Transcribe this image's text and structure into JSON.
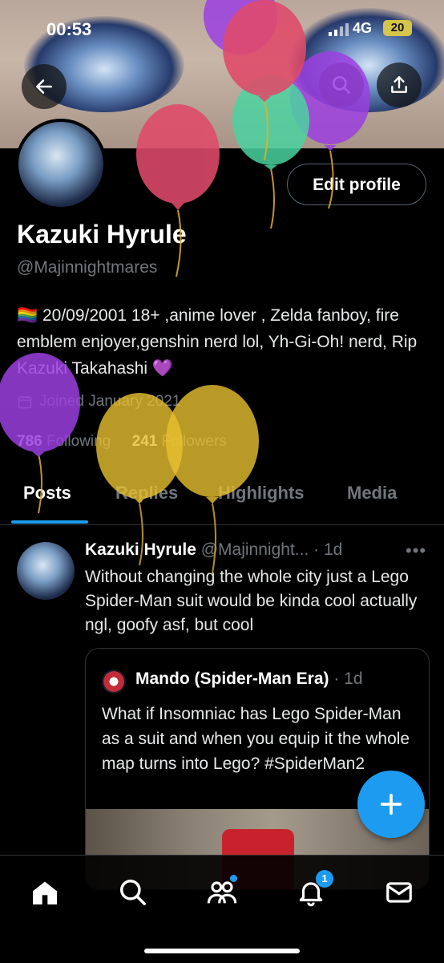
{
  "status_bar": {
    "time": "00:53",
    "network": "4G",
    "battery": "20"
  },
  "profile": {
    "name": "Kazuki Hyrule",
    "handle": "@Majinnightmares",
    "edit_label": "Edit profile",
    "bio": "🏳️‍🌈 20/09/2001 18+ ,anime lover , Zelda fanboy, fire emblem enjoyer,genshin nerd lol, Yh-Gi-Oh! nerd, Rip Kazuki Takahashi 💜",
    "joined": "Joined January 2021",
    "following_count": "786",
    "following_label": "Following",
    "followers_count": "241",
    "followers_label": "Followers"
  },
  "tabs": [
    "Posts",
    "Replies",
    "Highlights",
    "Media"
  ],
  "active_tab": "Posts",
  "post": {
    "author": "Kazuki Hyrule",
    "handle_time": "@Majinnight... · 1d",
    "text": "Without changing the whole city just a Lego Spider-Man suit would be kinda cool actually ngl, goofy asf, but cool",
    "quote": {
      "author": "Mando (Spider-Man Era)",
      "time": "· 1d",
      "text": "What if Insomniac has Lego Spider-Man as a suit and when you equip it the whole map turns into Lego? #SpiderMan2"
    }
  },
  "nav": {
    "notifications_badge": "1"
  },
  "icons": [
    "back-icon",
    "search-icon",
    "share-icon",
    "calendar-icon",
    "more-icon",
    "compose-icon",
    "home-icon",
    "search-icon",
    "communities-icon",
    "notifications-icon",
    "messages-icon"
  ],
  "colors": {
    "accent": "#1d9bf0",
    "background": "#000000",
    "muted": "#71767b"
  }
}
